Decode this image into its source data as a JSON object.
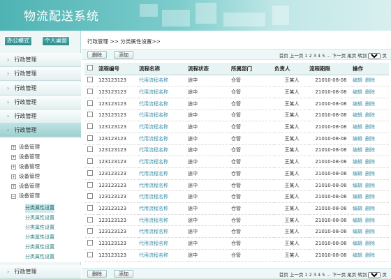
{
  "header": {
    "title": "物流配送系统"
  },
  "mode_buttons": [
    "办公模式",
    "个人桌面"
  ],
  "nav": [
    {
      "label": "行政管理"
    },
    {
      "label": "行政管理"
    },
    {
      "label": "行政管理"
    },
    {
      "label": "行政管理"
    },
    {
      "label": "行政管理"
    },
    {
      "label": "行政管理"
    }
  ],
  "nav_bottom": {
    "label": "行政管理"
  },
  "tree": [
    {
      "label": "设备管理"
    },
    {
      "label": "设备管理"
    },
    {
      "label": "设备管理"
    },
    {
      "label": "设备管理"
    },
    {
      "label": "设备管理"
    },
    {
      "label": "设备管理"
    }
  ],
  "sub_items": [
    {
      "label": "分类属性设置"
    },
    {
      "label": "分类属性设置"
    },
    {
      "label": "分类属性设置"
    },
    {
      "label": "分类属性设置"
    },
    {
      "label": "分类属性设置"
    },
    {
      "label": "分类属性设置"
    }
  ],
  "breadcrumb": "行政管理 >> 分类属性设置>>",
  "toolbar": {
    "delete_label": "删除",
    "add_label": "添加"
  },
  "pager": {
    "text": "首页  上一页 1 2 3 4 5 ... 下一页  尾页  转到",
    "page_value": "1",
    "page_suffix": "页"
  },
  "table": {
    "headers": [
      "流程编号",
      "流程名称",
      "流程状态",
      "所属部门",
      "负责人",
      "流程期限",
      "操作"
    ],
    "rows": [
      [
        "123123123",
        "代用流程名称",
        "途中",
        "仓管",
        "王某人",
        "21010-08-08"
      ],
      [
        "123123123",
        "代用流程名称",
        "途中",
        "仓管",
        "王某人",
        "21010-08-08"
      ],
      [
        "123123123",
        "代用流程名称",
        "途中",
        "仓管",
        "王某人",
        "21010-08-08"
      ],
      [
        "123123123",
        "代用流程名称",
        "途中",
        "仓管",
        "王某人",
        "21010-08-08"
      ],
      [
        "123123123",
        "代用流程名称",
        "途中",
        "仓管",
        "王某人",
        "21010-08-08"
      ],
      [
        "123123123",
        "代用流程名称",
        "途中",
        "仓管",
        "王某人",
        "21010-08-08"
      ],
      [
        "123123123",
        "代用流程名称",
        "途中",
        "仓管",
        "王某人",
        "21010-08-08"
      ],
      [
        "123123123",
        "代用流程名称",
        "途中",
        "仓管",
        "王某人",
        "21010-08-08"
      ],
      [
        "123123123",
        "代用流程名称",
        "途中",
        "仓管",
        "王某人",
        "21010-08-08"
      ],
      [
        "123123123",
        "代用流程名称",
        "途中",
        "仓管",
        "王某人",
        "21010-08-08"
      ],
      [
        "123123123",
        "代用流程名称",
        "途中",
        "仓管",
        "王某人",
        "21010-08-08"
      ],
      [
        "123123123",
        "代用流程名称",
        "途中",
        "仓管",
        "王某人",
        "21010-08-08"
      ],
      [
        "123123123",
        "代用流程名称",
        "途中",
        "仓管",
        "王某人",
        "21010-08-08"
      ],
      [
        "123123123",
        "代用流程名称",
        "途中",
        "仓管",
        "王某人",
        "21010-08-08"
      ],
      [
        "123123123",
        "代用流程名称",
        "途中",
        "仓管",
        "王某人",
        "21010-08-08"
      ],
      [
        "123123123",
        "代用流程名称",
        "途中",
        "仓管",
        "王某人",
        "21010-08-08"
      ]
    ],
    "op_edit": "编辑",
    "op_delete": "删除"
  },
  "colors": {
    "accent": "#4fb3b3",
    "link": "#3d8fa8"
  }
}
